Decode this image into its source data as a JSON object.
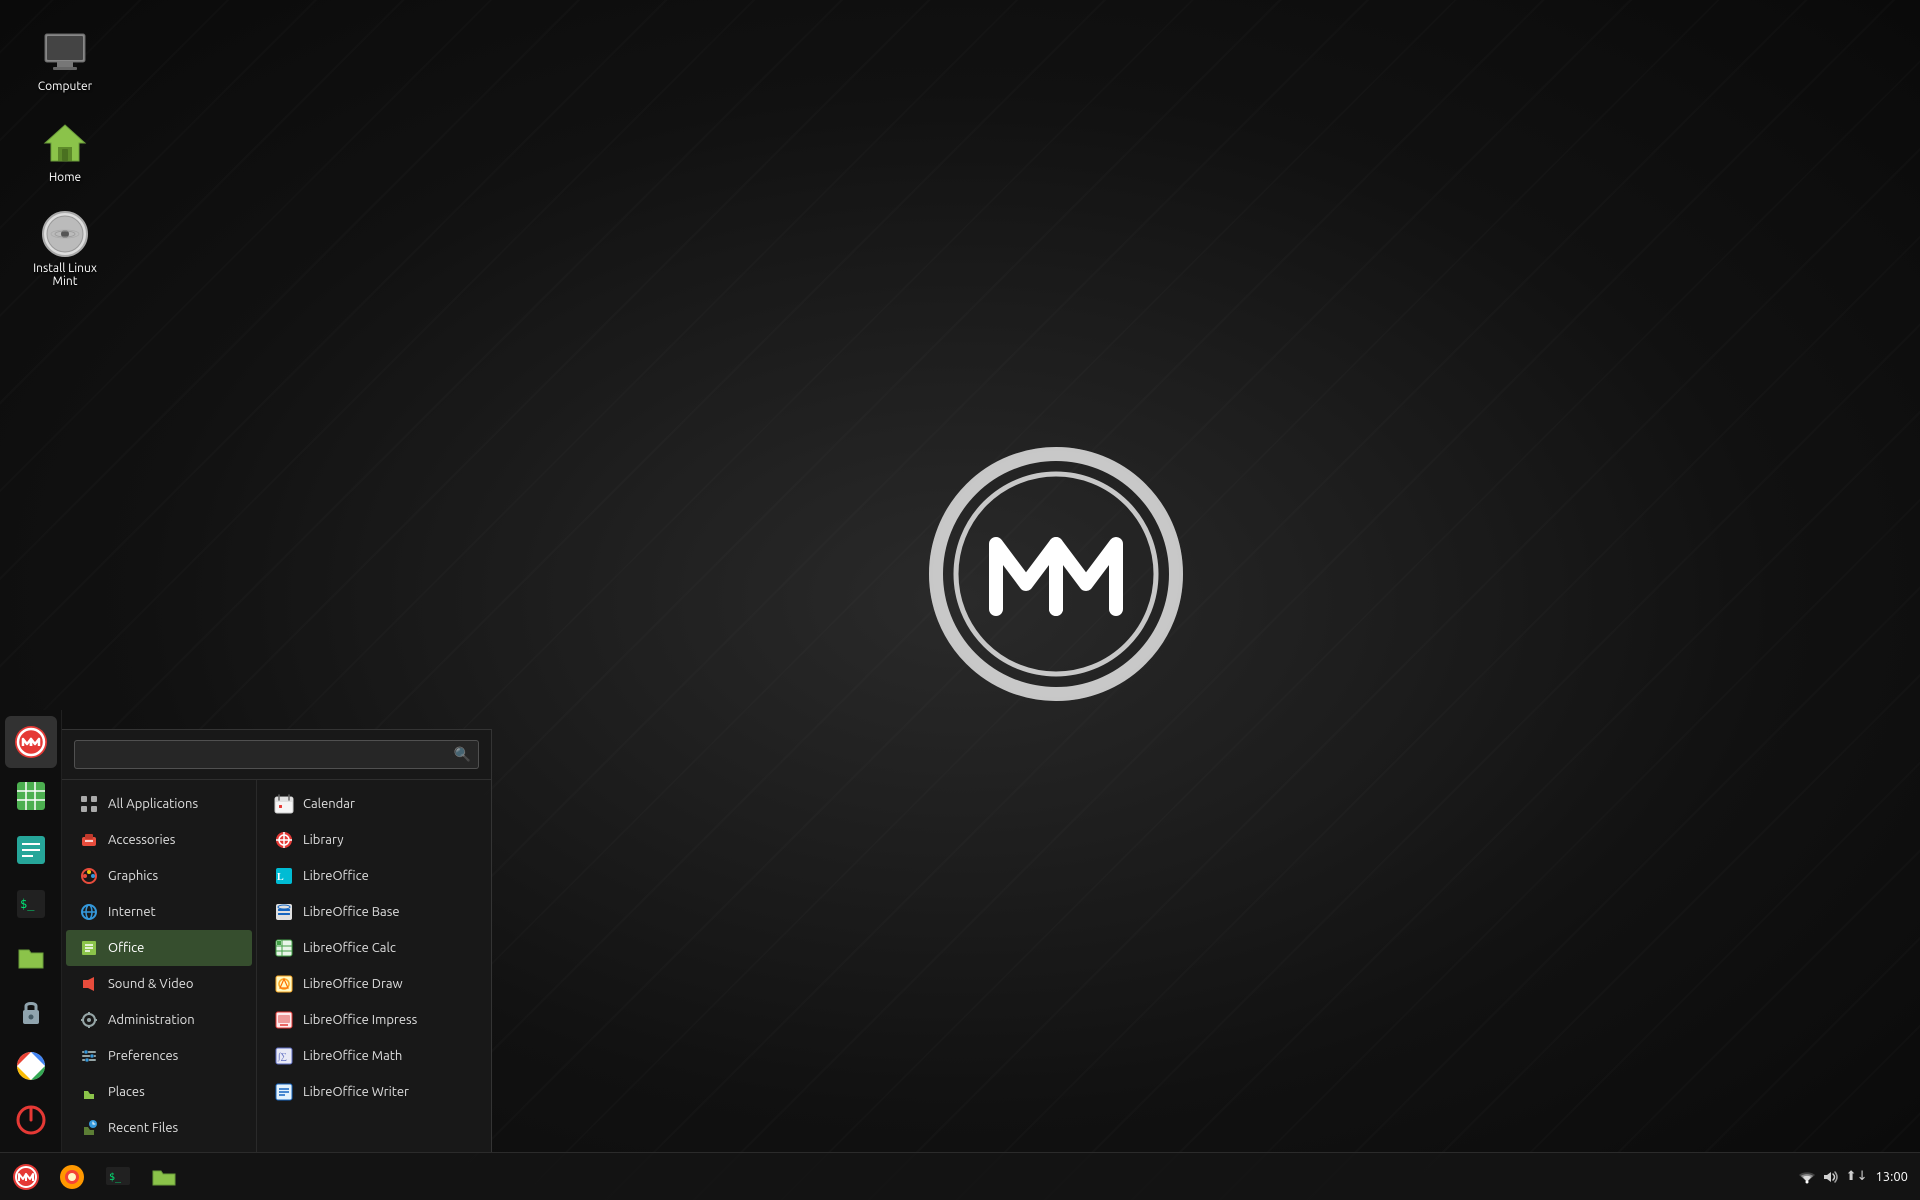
{
  "desktop": {
    "icons": [
      {
        "id": "computer",
        "label": "Computer",
        "icon": "computer"
      },
      {
        "id": "home",
        "label": "Home",
        "icon": "home"
      },
      {
        "id": "install",
        "label": "Install Linux Mint",
        "icon": "install"
      }
    ]
  },
  "sidebar": {
    "apps": [
      {
        "id": "mintmenu",
        "label": "Menu",
        "icon": "menu",
        "active": true
      },
      {
        "id": "spreadsheet",
        "label": "Spreadsheet",
        "icon": "spreadsheet"
      },
      {
        "id": "notes",
        "label": "Notes",
        "icon": "notes"
      },
      {
        "id": "terminal",
        "label": "Terminal",
        "icon": "terminal"
      },
      {
        "id": "files",
        "label": "Files",
        "icon": "files"
      },
      {
        "id": "lock",
        "label": "Lock",
        "icon": "lock"
      },
      {
        "id": "browser",
        "label": "Browser",
        "icon": "browser"
      },
      {
        "id": "power",
        "label": "Power",
        "icon": "power"
      }
    ]
  },
  "app_menu": {
    "search_placeholder": "",
    "categories": [
      {
        "id": "all",
        "label": "All Applications",
        "icon": "grid",
        "selected": false
      },
      {
        "id": "accessories",
        "label": "Accessories",
        "icon": "accessories"
      },
      {
        "id": "graphics",
        "label": "Graphics",
        "icon": "graphics"
      },
      {
        "id": "internet",
        "label": "Internet",
        "icon": "internet"
      },
      {
        "id": "office",
        "label": "Office",
        "icon": "office",
        "selected": true
      },
      {
        "id": "sound-video",
        "label": "Sound & Video",
        "icon": "media"
      },
      {
        "id": "administration",
        "label": "Administration",
        "icon": "admin"
      },
      {
        "id": "preferences",
        "label": "Preferences",
        "icon": "prefs"
      },
      {
        "id": "places",
        "label": "Places",
        "icon": "places"
      },
      {
        "id": "recent",
        "label": "Recent Files",
        "icon": "recent"
      }
    ],
    "apps": [
      {
        "id": "calendar",
        "label": "Calendar",
        "icon": "calendar"
      },
      {
        "id": "library",
        "label": "Library",
        "icon": "library"
      },
      {
        "id": "libreoffice",
        "label": "LibreOffice",
        "icon": "libreoffice"
      },
      {
        "id": "libreoffice-base",
        "label": "LibreOffice Base",
        "icon": "lobase"
      },
      {
        "id": "libreoffice-calc",
        "label": "LibreOffice Calc",
        "icon": "localc"
      },
      {
        "id": "libreoffice-draw",
        "label": "LibreOffice Draw",
        "icon": "lodraw"
      },
      {
        "id": "libreoffice-impress",
        "label": "LibreOffice Impress",
        "icon": "loimpress"
      },
      {
        "id": "libreoffice-math",
        "label": "LibreOffice Math",
        "icon": "lomath"
      },
      {
        "id": "libreoffice-writer",
        "label": "LibreOffice Writer",
        "icon": "lowriter"
      }
    ]
  },
  "taskbar": {
    "clock": "13:00",
    "buttons": [
      {
        "id": "menu",
        "label": "Menu"
      },
      {
        "id": "firefox",
        "label": "Firefox"
      },
      {
        "id": "terminal",
        "label": "Terminal"
      },
      {
        "id": "files",
        "label": "Files"
      }
    ]
  }
}
